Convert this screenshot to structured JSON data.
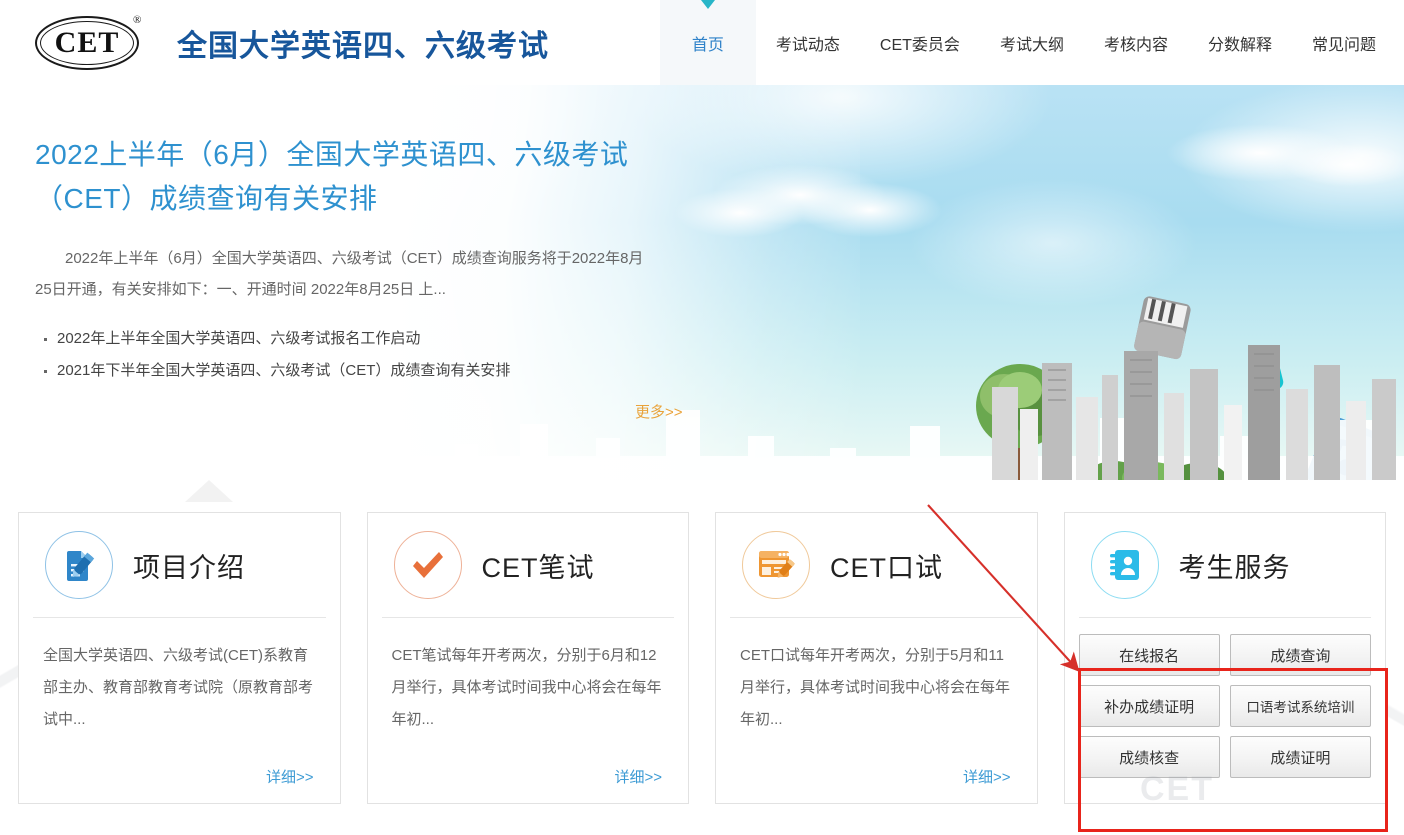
{
  "header": {
    "logo_text": "CET",
    "logo_reg": "®",
    "brand_title": "全国大学英语四、六级考试",
    "nav": [
      {
        "label": "首页",
        "active": true
      },
      {
        "label": "考试动态",
        "active": false
      },
      {
        "label": "CET委员会",
        "active": false
      },
      {
        "label": "考试大纲",
        "active": false
      },
      {
        "label": "考核内容",
        "active": false
      },
      {
        "label": "分数解释",
        "active": false
      },
      {
        "label": "常见问题",
        "active": false
      }
    ]
  },
  "hero": {
    "title": "2022上半年（6月）全国大学英语四、六级考试（CET）成绩查询有关安排",
    "summary": "2022年上半年（6月）全国大学英语四、六级考试（CET）成绩查询服务将于2022年8月25日开通，有关安排如下：一、开通时间  2022年8月25日 上...",
    "list": [
      "2022年上半年全国大学英语四、六级考试报名工作启动",
      "2021年下半年全国大学英语四、六级考试（CET）成绩查询有关安排"
    ],
    "more_label": "更多>>"
  },
  "cards": [
    {
      "title": "项目介绍",
      "icon": "document-pencil-icon",
      "accent": "#2f86c9",
      "body": "全国大学英语四、六级考试(CET)系教育部主办、教育部教育考试院（原教育部考试中...",
      "detail_label": "详细>>"
    },
    {
      "title": "CET笔试",
      "icon": "checkmark-icon",
      "accent": "#e8703a",
      "body": "CET笔试每年开考两次，分别于6月和12月举行，具体考试时间我中心将会在每年年初...",
      "detail_label": "详细>>"
    },
    {
      "title": "CET口试",
      "icon": "form-pencil-icon",
      "accent": "#ef9632",
      "body": "CET口试每年开考两次，分别于5月和11月举行，具体考试时间我中心将会在每年年初...",
      "detail_label": "详细>>"
    },
    {
      "title": "考生服务",
      "icon": "contact-book-icon",
      "accent": "#2bbbe8",
      "buttons": [
        {
          "label": "在线报名",
          "small": false
        },
        {
          "label": "成绩查询",
          "small": false
        },
        {
          "label": "补办成绩证明",
          "small": false
        },
        {
          "label": "口语考试系统培训",
          "small": true
        },
        {
          "label": "成绩核查",
          "small": false
        },
        {
          "label": "成绩证明",
          "small": false
        }
      ]
    }
  ],
  "annotation": {
    "highlight_color": "#e8241b",
    "arrow_color": "#d6302a",
    "arrow_from": "928,505",
    "arrow_to": "1080,672"
  },
  "watermark": {
    "text": "CET"
  }
}
